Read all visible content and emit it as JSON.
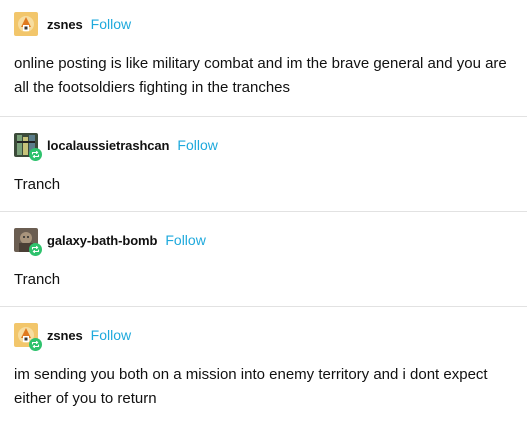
{
  "colors": {
    "follow_link": "#1ea9dc",
    "reblog_badge": "#2ec26d",
    "divider": "#e2e2e2"
  },
  "icons": {
    "reblog": "reblog-icon"
  },
  "posts": [
    {
      "username": "zsnes",
      "follow_label": "Follow",
      "text": "online posting is like military combat and im the brave general and you are all the footsoldiers fighting in the tranches",
      "reblogged": false
    },
    {
      "username": "localaussietrashcan",
      "follow_label": "Follow",
      "text": "Tranch",
      "reblogged": true
    },
    {
      "username": "galaxy-bath-bomb",
      "follow_label": "Follow",
      "text": "Tranch",
      "reblogged": true
    },
    {
      "username": "zsnes",
      "follow_label": "Follow",
      "text": "im sending you both on a mission into enemy territory and i dont expect either of you to return",
      "reblogged": true
    }
  ]
}
